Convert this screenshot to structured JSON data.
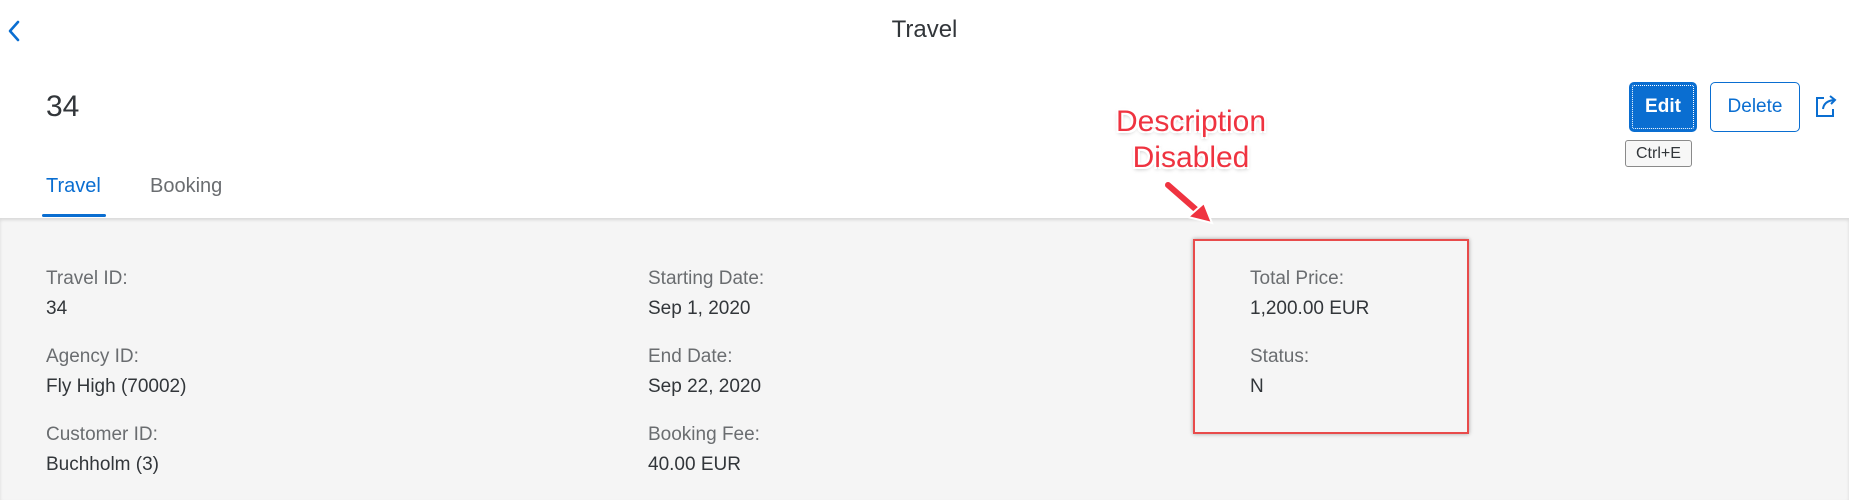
{
  "app": {
    "title": "Travel"
  },
  "object": {
    "title": "34"
  },
  "actions": {
    "edit_label": "Edit",
    "delete_label": "Delete",
    "edit_shortcut": "Ctrl+E"
  },
  "tabs": [
    {
      "label": "Travel",
      "selected": true
    },
    {
      "label": "Booking",
      "selected": false
    }
  ],
  "fields": {
    "travel_id": {
      "label": "Travel ID:",
      "value": "34"
    },
    "agency_id": {
      "label": "Agency ID:",
      "value": "Fly High (70002)"
    },
    "customer_id": {
      "label": "Customer ID:",
      "value": "Buchholm (3)"
    },
    "starting_date": {
      "label": "Starting Date:",
      "value": "Sep 1, 2020"
    },
    "end_date": {
      "label": "End Date:",
      "value": "Sep 22, 2020"
    },
    "booking_fee": {
      "label": "Booking Fee:",
      "value": "40.00  EUR"
    },
    "total_price": {
      "label": "Total Price:",
      "value": "1,200.00  EUR"
    },
    "status": {
      "label": "Status:",
      "value": "N"
    }
  },
  "annotation": {
    "line1": "Description",
    "line2": "Disabled"
  },
  "colors": {
    "accent": "#0a6ed1",
    "annotation": "#ef3340",
    "content_bg": "#f5f5f5"
  },
  "icons": {
    "back": "chevron-left-icon",
    "share": "share-icon"
  }
}
